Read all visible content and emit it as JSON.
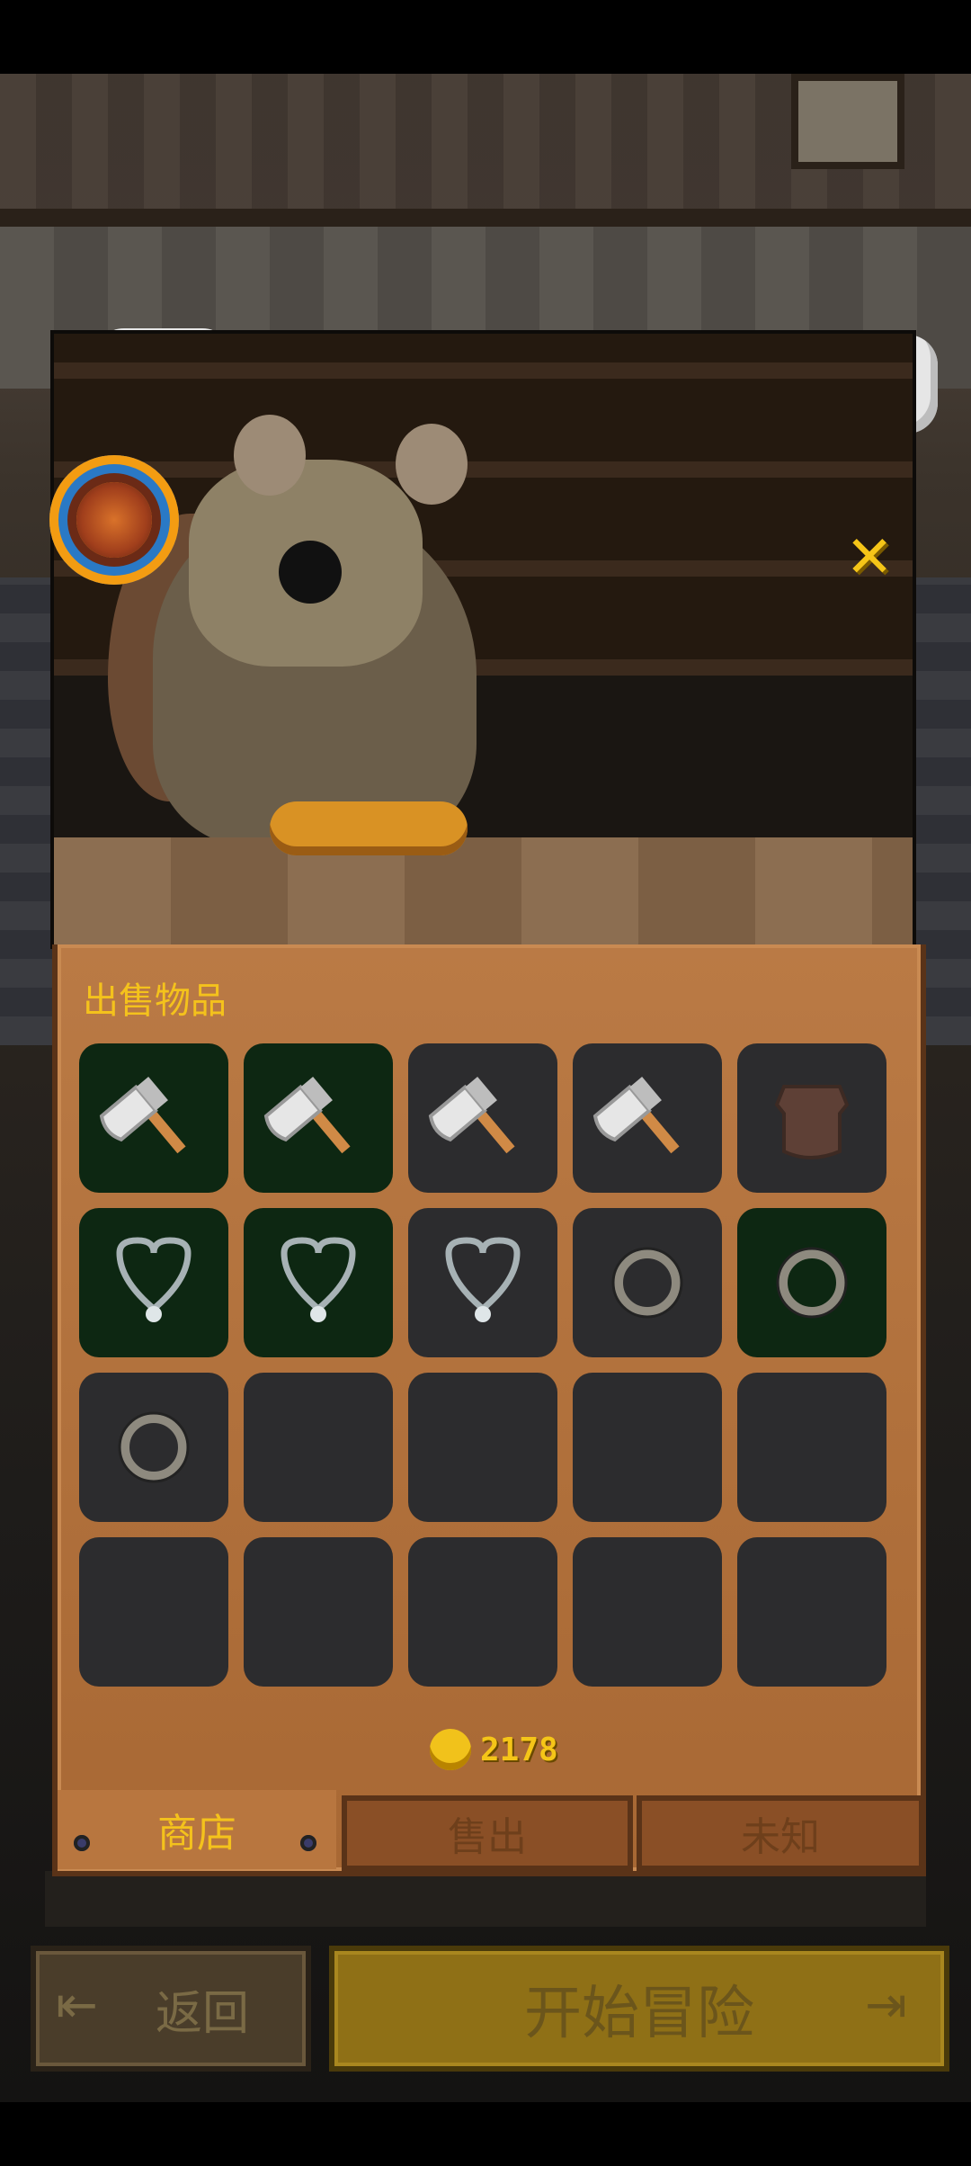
{
  "panel": {
    "title": "出售物品",
    "currency_value": "2178"
  },
  "grid": {
    "rows": [
      [
        {
          "item": "axe-icon",
          "rarity": "green"
        },
        {
          "item": "axe-icon",
          "rarity": "green"
        },
        {
          "item": "axe-icon",
          "rarity": "normal"
        },
        {
          "item": "axe-icon",
          "rarity": "normal"
        },
        {
          "item": "leather-armor-icon",
          "rarity": "normal"
        }
      ],
      [
        {
          "item": "necklace-icon",
          "rarity": "green"
        },
        {
          "item": "necklace-icon",
          "rarity": "green"
        },
        {
          "item": "necklace-icon",
          "rarity": "normal"
        },
        {
          "item": "ring-icon",
          "rarity": "normal"
        },
        {
          "item": "ring-icon",
          "rarity": "green"
        }
      ],
      [
        {
          "item": "ring-icon",
          "rarity": "normal"
        },
        {
          "item": "empty",
          "rarity": "normal"
        },
        {
          "item": "empty",
          "rarity": "normal"
        },
        {
          "item": "empty",
          "rarity": "normal"
        },
        {
          "item": "empty",
          "rarity": "normal"
        }
      ],
      [
        {
          "item": "empty",
          "rarity": "normal"
        },
        {
          "item": "empty",
          "rarity": "normal"
        },
        {
          "item": "empty",
          "rarity": "normal"
        },
        {
          "item": "empty",
          "rarity": "normal"
        },
        {
          "item": "empty",
          "rarity": "normal"
        }
      ]
    ]
  },
  "tabs": {
    "shop": "商店",
    "sell": "售出",
    "unknown": "未知"
  },
  "buttons": {
    "back": "返回",
    "start": "开始冒险"
  },
  "colors": {
    "gold_text": "#f4c21c",
    "slot_normal": "#2c2c2e",
    "slot_green": "#0d2712"
  }
}
